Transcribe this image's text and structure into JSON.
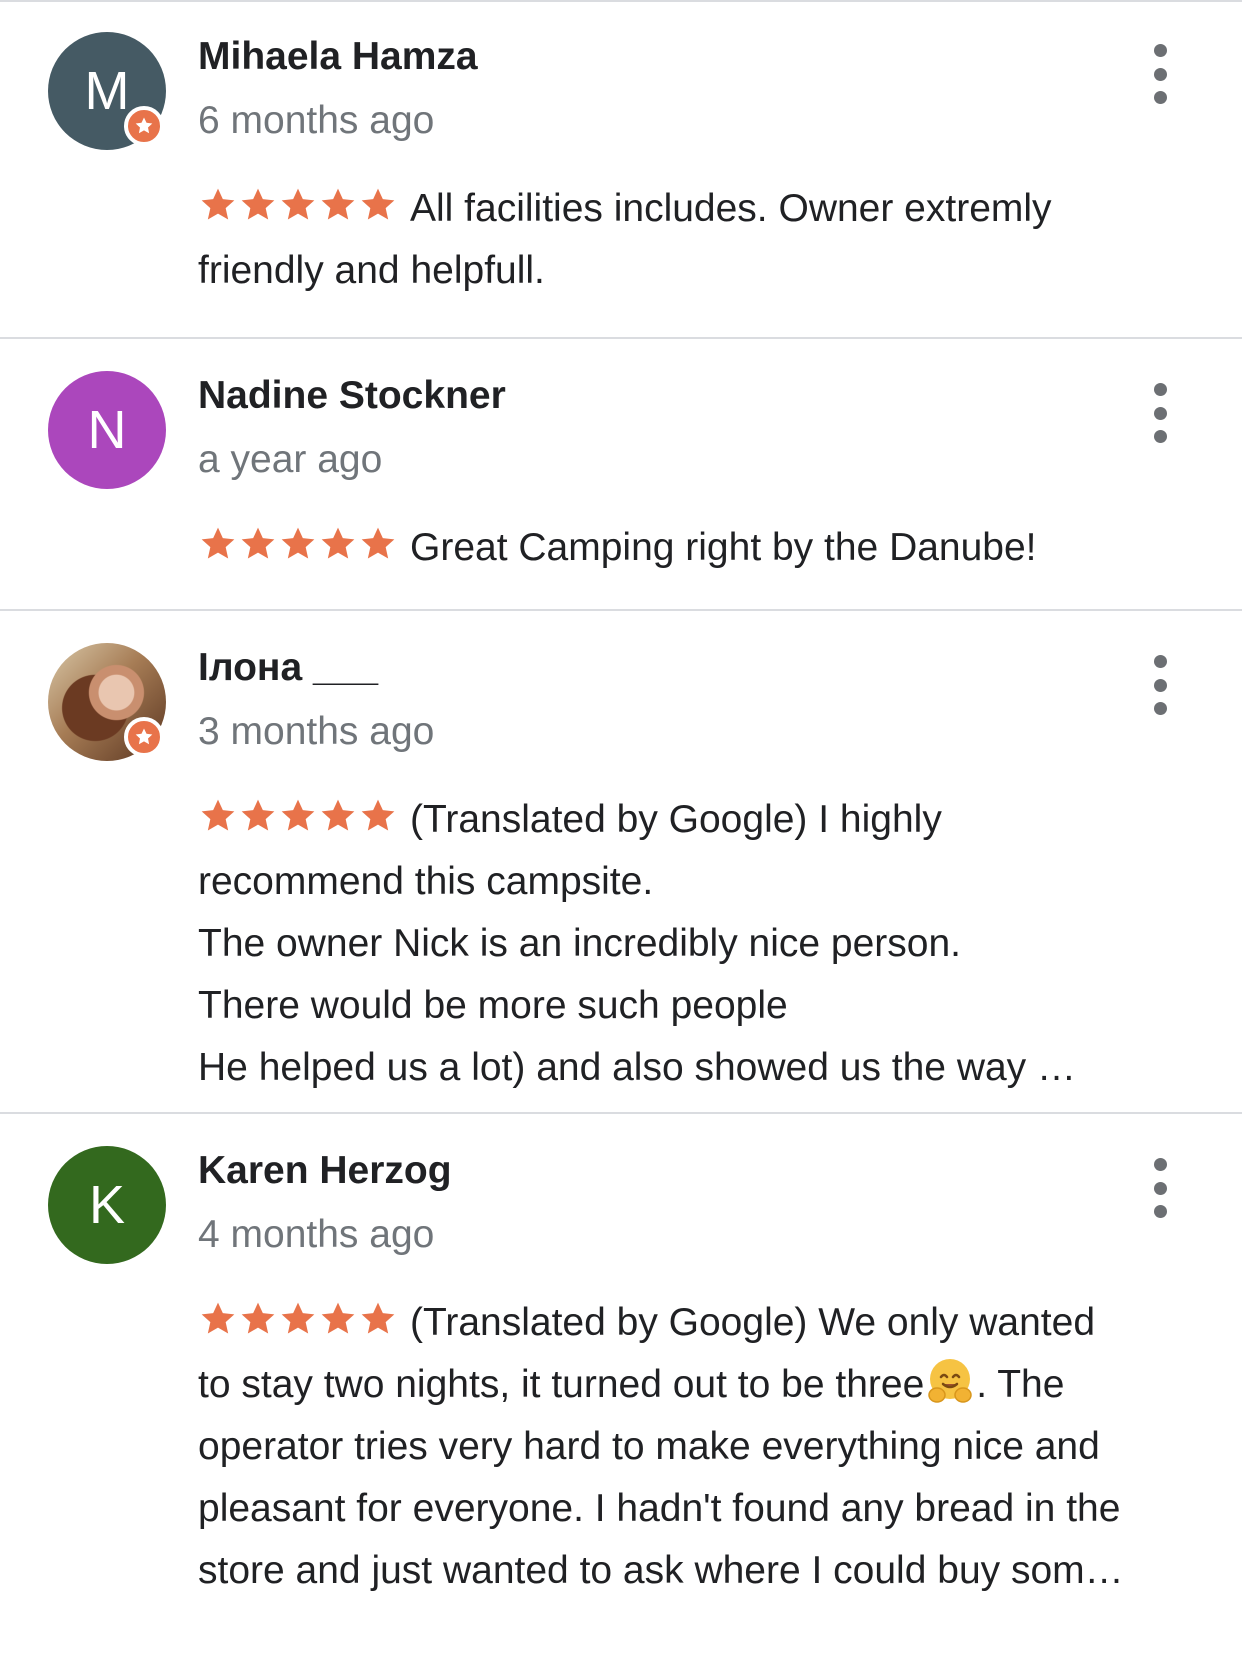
{
  "colors": {
    "star": "#e8734a",
    "divider": "#dadce0",
    "name_text": "#202124",
    "date_text": "#70757a",
    "menu_dots": "#6c6f73",
    "local_guide_badge": "#e8734a"
  },
  "reviews": [
    {
      "author": "Mihaela Hamza",
      "avatar_letter": "M",
      "avatar_color": "#455a64",
      "local_guide": true,
      "date": "6 months ago",
      "rating": 5,
      "lines": [
        "All facilities includes. Owner extremly",
        "friendly and helpfull."
      ]
    },
    {
      "author": "Nadine Stockner",
      "avatar_letter": "N",
      "avatar_color": "#ab47bc",
      "local_guide": false,
      "date": "a year ago",
      "rating": 5,
      "lines": [
        "Great Camping right by the Danube!"
      ]
    },
    {
      "author": "Ілона ___",
      "avatar_letter": "",
      "avatar_color": "photo",
      "local_guide": true,
      "date": "3 months ago",
      "rating": 5,
      "lines": [
        "(Translated by Google) I highly",
        "recommend this campsite.",
        "The owner Nick is an incredibly nice person.",
        "There would be more such people",
        "He helped us a lot) and also showed us the way …"
      ]
    },
    {
      "author": "Karen Herzog",
      "avatar_letter": "K",
      "avatar_color": "#33691e",
      "local_guide": false,
      "date": "4 months ago",
      "rating": 5,
      "lines": [
        "(Translated by Google) We only wanted",
        "to stay two nights, it turned out to be three",
        "operator tries very hard to make everything nice and",
        "pleasant for everyone. I hadn't found any bread in the",
        "store and just wanted to ask where I could buy som…"
      ],
      "line_after_emoji": ". The",
      "emoji": "hugging-face-emoji"
    }
  ]
}
